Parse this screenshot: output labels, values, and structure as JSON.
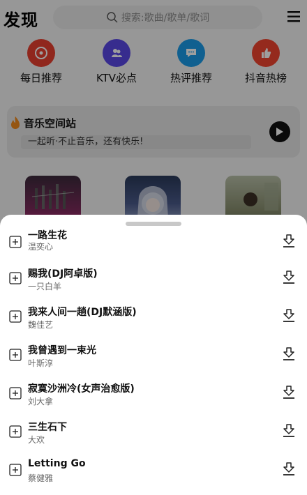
{
  "app": {
    "logo": "发现"
  },
  "search": {
    "placeholder": "搜索:歌曲/歌单/歌词"
  },
  "categories": [
    {
      "label": "每日推荐",
      "icon": "disc-icon",
      "color": "#e8402f"
    },
    {
      "label": "KTV必点",
      "icon": "users-icon",
      "color": "#5a48e6"
    },
    {
      "label": "热评推荐",
      "icon": "chat-icon",
      "color": "#1a9ce8"
    },
    {
      "label": "抖音热榜",
      "icon": "thumbs-up-icon",
      "color": "#f0442f"
    }
  ],
  "music_space": {
    "title": "音乐空间站",
    "subtitle": "一起听·不止音乐，还有快乐!"
  },
  "songs": [
    {
      "name": "一路生花",
      "artist": "温奕心"
    },
    {
      "name": "赐我(DJ阿卓版)",
      "artist": "一只白羊"
    },
    {
      "name": "我来人间一趟(DJ默涵版)",
      "artist": "魏佳艺"
    },
    {
      "name": "我曾遇到一束光",
      "artist": "叶斯淳"
    },
    {
      "name": "寂寞沙洲冷(女声治愈版)",
      "artist": "刘大拿"
    },
    {
      "name": "三生石下",
      "artist": "大欢"
    },
    {
      "name": "Letting Go",
      "artist": "蔡健雅"
    }
  ]
}
